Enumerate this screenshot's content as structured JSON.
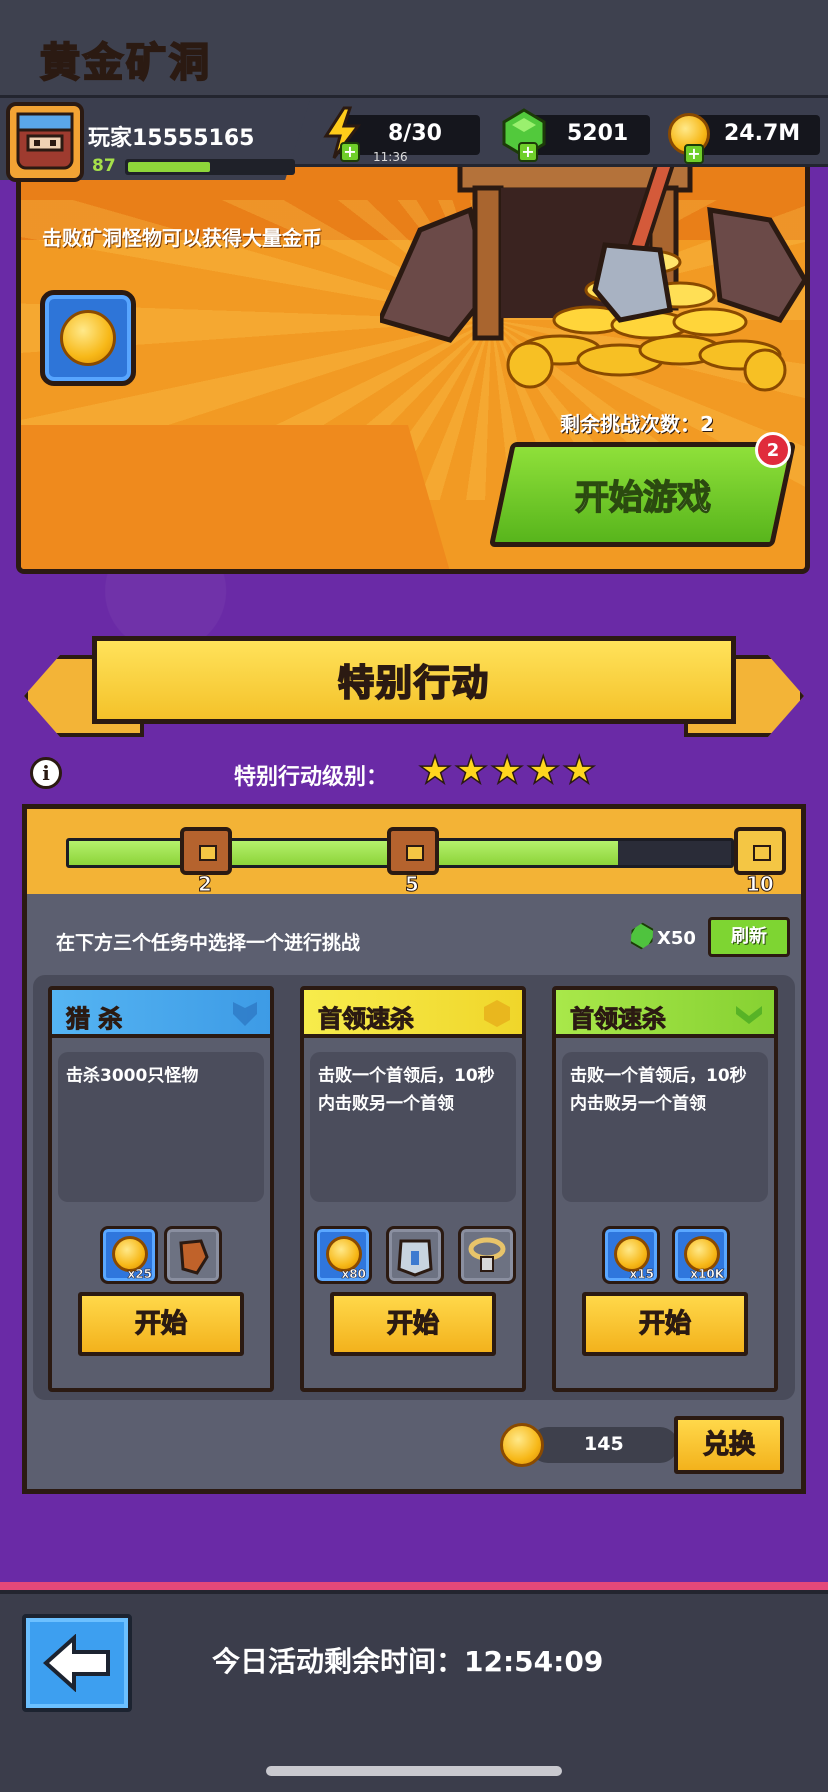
{
  "header": {
    "player_name": "玩家15555165",
    "level": "87",
    "level_progress": 0.5,
    "energy": "8/30",
    "energy_timer": "11:36",
    "gems": "5201",
    "gold": "24.7M",
    "plus_symbol": "+"
  },
  "mine": {
    "title": "黄金矿洞",
    "description": "击败矿洞怪物可以获得大量金币",
    "remaining_attempts": "剩余挑战次数：2",
    "start_button": "开始游戏",
    "badge": "2"
  },
  "special": {
    "title": "特别行动",
    "info_glyph": "i",
    "level_label": "特别行动级别：",
    "stars": "★★★★★",
    "progress_fraction": 0.83,
    "milestones": [
      "2",
      "5",
      "10"
    ],
    "instruction": "在下方三个任务中选择一个进行挑战",
    "refresh_cost": "X50",
    "refresh_button": "刷新"
  },
  "tasks": [
    {
      "title": "猎 杀",
      "description": "击杀3000只怪物",
      "rewards": [
        "x25",
        ""
      ],
      "start": "开始"
    },
    {
      "title": "首领速杀",
      "description": "击败一个首领后，10秒内击败另一个首领",
      "rewards": [
        "x80",
        "",
        ""
      ],
      "start": "开始"
    },
    {
      "title": "首领速杀",
      "description": "击败一个首领后，10秒内击败另一个首领",
      "rewards": [
        "x15",
        "x10K"
      ],
      "start": "开始"
    }
  ],
  "exchange": {
    "token_count": "145",
    "button": "兑换"
  },
  "footer": {
    "timer_label": "今日活动剩余时间：",
    "timer_value": "12:54:09"
  },
  "colors": {
    "purple_bg": "#6a2aa6",
    "gold_accent": "#f3b336",
    "green_accent": "#7ed532",
    "hunt_header": "#4aa8ec",
    "boss_header": "#f1e23a",
    "boss_header_green": "#9be03a"
  },
  "icons": [
    "avatar",
    "energy-icon",
    "gem-icon",
    "gold-coin-icon",
    "shovel-icon",
    "chest-icon",
    "info-icon",
    "star-icon",
    "back-arrow-icon"
  ]
}
